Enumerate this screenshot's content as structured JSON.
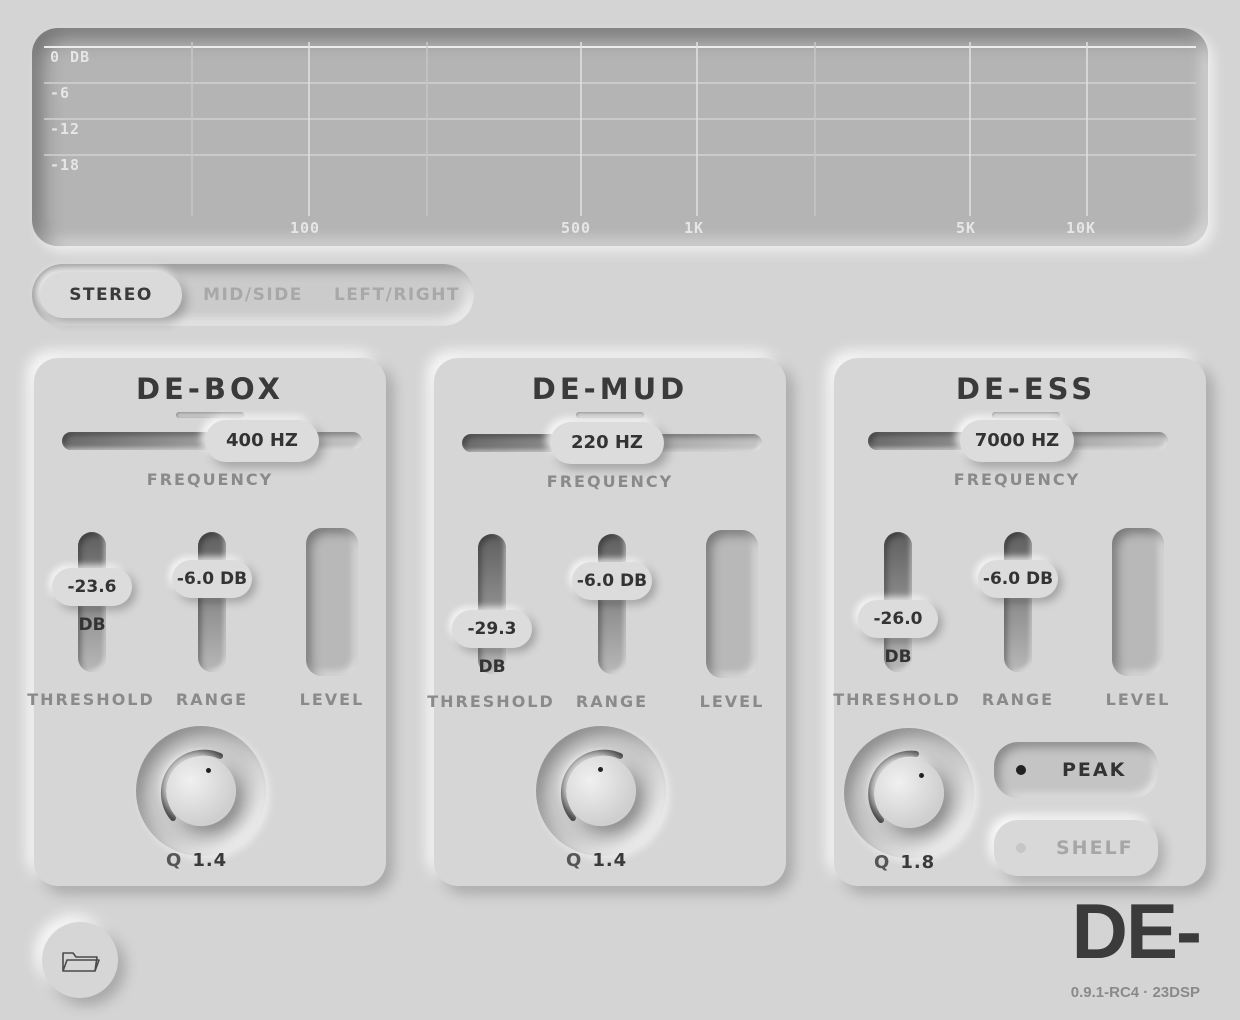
{
  "spectrum": {
    "db_labels": [
      "0 DB",
      "-6",
      "-12",
      "-18"
    ],
    "hz_labels": [
      "100",
      "500",
      "1K",
      "5K",
      "10K"
    ]
  },
  "mode_switch": {
    "options": [
      "STEREO",
      "MID/SIDE",
      "LEFT/RIGHT"
    ],
    "selected": "STEREO"
  },
  "bands": [
    {
      "title": "DE-BOX",
      "frequency": "400 HZ",
      "frequency_label": "FREQUENCY",
      "threshold": "-23.6 DB",
      "threshold_label": "THRESHOLD",
      "range": "-6.0 DB",
      "range_label": "RANGE",
      "level_label": "LEVEL",
      "q_prefix": "Q",
      "q_value": "1.4"
    },
    {
      "title": "DE-MUD",
      "frequency": "220 HZ",
      "frequency_label": "FREQUENCY",
      "threshold": "-29.3 DB",
      "threshold_label": "THRESHOLD",
      "range": "-6.0 DB",
      "range_label": "RANGE",
      "level_label": "LEVEL",
      "q_prefix": "Q",
      "q_value": "1.4"
    },
    {
      "title": "DE-ESS",
      "frequency": "7000 HZ",
      "frequency_label": "FREQUENCY",
      "threshold": "-26.0 DB",
      "threshold_label": "THRESHOLD",
      "range": "-6.0 DB",
      "range_label": "RANGE",
      "level_label": "LEVEL",
      "q_prefix": "Q",
      "q_value": "1.8",
      "filter_modes": [
        "PEAK",
        "SHELF"
      ],
      "filter_mode_selected": "PEAK"
    }
  ],
  "footer": {
    "folder_icon": "folder-icon",
    "logo": "DE-",
    "version": "0.9.1-RC4 · 23DSP"
  },
  "colors": {
    "background": "#d4d4d4",
    "display": "#b4b4b4",
    "text_dark": "#3a3a3a",
    "text_muted": "#8a8a8a"
  }
}
